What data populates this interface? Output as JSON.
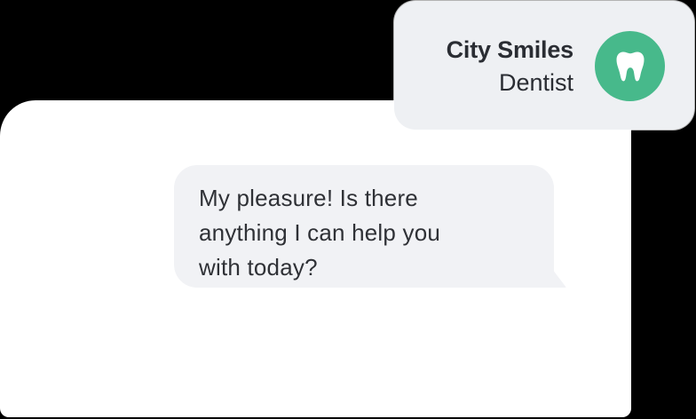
{
  "contact": {
    "name": "City Smiles",
    "role": "Dentist",
    "avatar_icon": "tooth-icon",
    "avatar_color": "#47b98b"
  },
  "conversation": {
    "messages": [
      {
        "text_lines": [
          "My pleasure! Is there",
          "anything I can help you",
          "with today?"
        ]
      }
    ]
  },
  "colors": {
    "background": "#000000",
    "panel": "#ffffff",
    "bubble": "#f1f2f5",
    "card": "#eef0f3",
    "text": "#2f3136"
  }
}
